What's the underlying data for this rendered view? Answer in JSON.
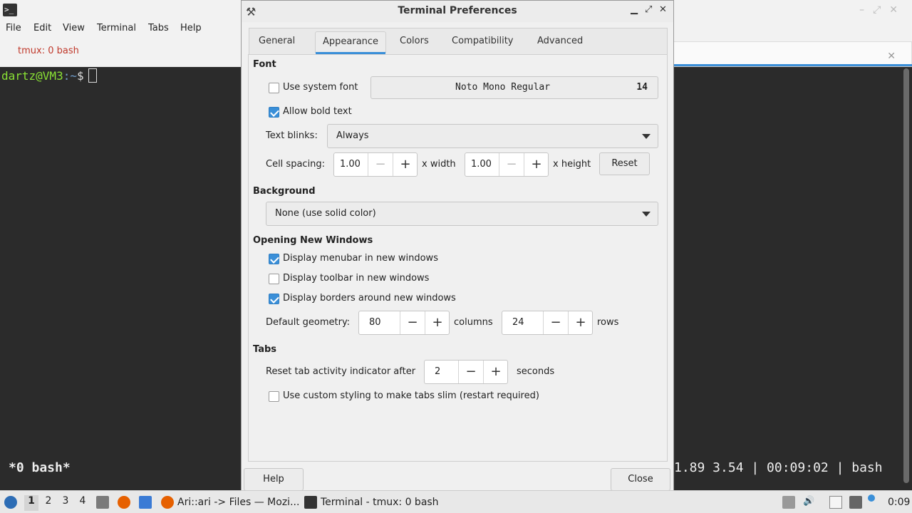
{
  "background_window": {
    "menu": [
      "File",
      "Edit",
      "View",
      "Terminal",
      "Tabs",
      "Help"
    ],
    "tab_label": "tmux: 0 bash",
    "prompt_user": "dartz@VM3",
    "prompt_path": ":~",
    "prompt_symbol": "$",
    "status_left": "*0 bash*",
    "status_right": "1.89 3.54 | 00:09:02 | bash",
    "close_glyph": "✕"
  },
  "dialog": {
    "title": "Terminal Preferences",
    "tabs": [
      "General",
      "Appearance",
      "Colors",
      "Compatibility",
      "Advanced"
    ],
    "active_tab": "Appearance",
    "font": {
      "section": "Font",
      "use_system_font": "Use system font",
      "use_system_font_checked": false,
      "font_name": "Noto Mono Regular",
      "font_size": "14",
      "allow_bold": "Allow bold text",
      "allow_bold_checked": true,
      "text_blinks_label": "Text blinks:",
      "text_blinks_value": "Always",
      "cell_spacing_label": "Cell spacing:",
      "width_value": "1.00",
      "width_unit": "x width",
      "height_value": "1.00",
      "height_unit": "x height",
      "reset": "Reset"
    },
    "background": {
      "section": "Background",
      "value": "None (use solid color)"
    },
    "new_windows": {
      "section": "Opening New Windows",
      "menubar": "Display menubar in new windows",
      "menubar_checked": true,
      "toolbar": "Display toolbar in new windows",
      "toolbar_checked": false,
      "borders": "Display borders around new windows",
      "borders_checked": true,
      "geometry_label": "Default geometry:",
      "columns_value": "80",
      "columns_unit": "columns",
      "rows_value": "24",
      "rows_unit": "rows"
    },
    "tabs_section": {
      "section": "Tabs",
      "reset_label": "Reset tab activity indicator after",
      "reset_value": "2",
      "reset_unit": "seconds",
      "slim": "Use custom styling to make tabs slim (restart required)",
      "slim_checked": false
    },
    "buttons": {
      "help": "Help",
      "close": "Close"
    },
    "glyphs": {
      "minus": "−",
      "plus": "+",
      "minimize": "▁",
      "maximize": "⤢",
      "close": "✕"
    }
  },
  "taskbar": {
    "workspaces": [
      "1",
      "2",
      "3",
      "4"
    ],
    "active_workspace": "1",
    "task1": "Ari::ari -> Files — Mozi...",
    "task2": "Terminal - tmux: 0 bash",
    "clock": "0:09"
  },
  "colors": {
    "accent": "#3a8fd8",
    "terminal_bg": "#2b2b2b",
    "prompt_green": "#8ae234",
    "tab_red": "#c0392b"
  }
}
